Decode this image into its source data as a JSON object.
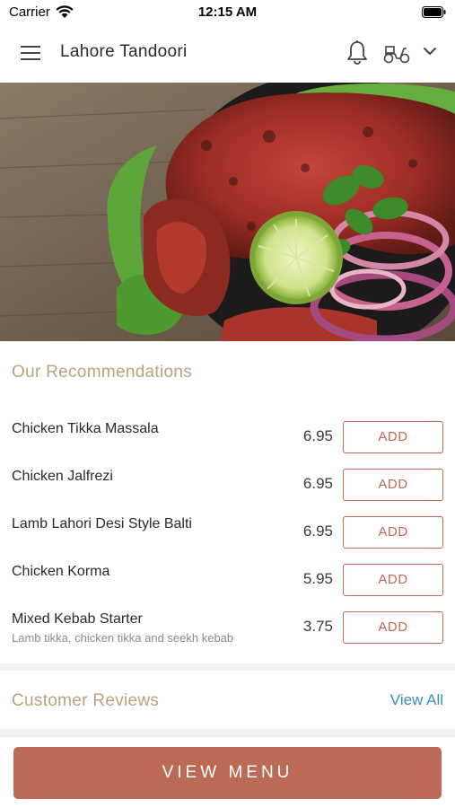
{
  "status_bar": {
    "carrier": "Carrier",
    "time": "12:15 AM"
  },
  "header": {
    "title": "Lahore Tandoori"
  },
  "recommendations": {
    "title": "Our Recommendations",
    "add_label": "ADD",
    "items": [
      {
        "name": "Chicken Tikka Massala",
        "price": "6.95",
        "description": ""
      },
      {
        "name": "Chicken Jalfrezi",
        "price": "6.95",
        "description": ""
      },
      {
        "name": "Lamb Lahori Desi Style Balti",
        "price": "6.95",
        "description": ""
      },
      {
        "name": "Chicken Korma",
        "price": "5.95",
        "description": ""
      },
      {
        "name": "Mixed Kebab Starter",
        "price": "3.75",
        "description": "Lamb tikka, chicken tikka and seekh kebab"
      }
    ]
  },
  "reviews": {
    "title": "Customer Reviews",
    "view_all": "View All"
  },
  "bottom": {
    "view_menu": "VIEW MENU"
  },
  "colors": {
    "accent": "#bb6a56",
    "section_title": "#b8a47c",
    "link": "#3a8fb4"
  },
  "icons": [
    "wifi-icon",
    "battery-icon",
    "hamburger-menu-icon",
    "bell-icon",
    "scooter-icon",
    "chevron-down-icon"
  ]
}
